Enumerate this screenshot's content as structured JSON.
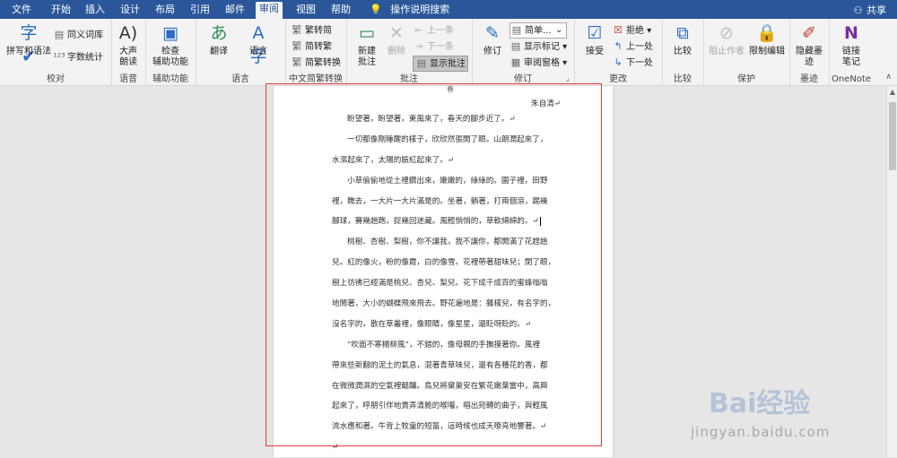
{
  "menu": {
    "tabs": [
      "文件",
      "开始",
      "插入",
      "设计",
      "布局",
      "引用",
      "邮件",
      "审阅",
      "视图",
      "帮助",
      "操作说明搜索"
    ],
    "active": "审阅",
    "share": "共享"
  },
  "ribbon": {
    "proofing": {
      "spell": "拼写和语法",
      "thesaurus": "同义词库",
      "wordcount": "字数统计",
      "label": "校对"
    },
    "speech": {
      "readaloud_1": "大声",
      "readaloud_2": "朗读",
      "label": "语音"
    },
    "accessibility": {
      "check_1": "检查",
      "check_2": "辅助功能",
      "label": "辅助功能"
    },
    "language": {
      "translate": "翻译",
      "language": "语言",
      "label": "语言"
    },
    "chinese": {
      "t2s": "繁转简",
      "s2t": "简转繁",
      "convert": "简繁转换",
      "label": "中文简繁转换"
    },
    "comments": {
      "new_1": "新建",
      "new_2": "批注",
      "delete": "删除",
      "prev": "上一条",
      "next": "下一条",
      "show": "显示批注",
      "label": "批注"
    },
    "tracking": {
      "track": "修订",
      "markup_select": "简单...",
      "show_markup": "显示标记",
      "review_pane": "审阅窗格",
      "label": "修订"
    },
    "changes": {
      "accept": "接受",
      "reject": "拒绝",
      "previous": "上一处",
      "next": "下一处",
      "label": "更改"
    },
    "compare": {
      "compare": "比较",
      "label": "比较"
    },
    "protect": {
      "block": "阻止作者",
      "restrict": "限制编辑",
      "label": "保护"
    },
    "ink": {
      "hide_1": "隐藏墨",
      "hide_2": "迹",
      "label": "墨迹"
    },
    "onenote": {
      "link_1": "链接",
      "link_2": "笔记",
      "label": "OneNote"
    }
  },
  "document": {
    "top_mark": "春",
    "author": "朱自清↵",
    "lines": [
      {
        "t": "盼望著，盼望著，東風來了，春天的腳步近了。↵",
        "indent": true
      },
      {
        "t": "一切都像剛睡醒的樣子，欣欣然張開了眼。山朗潤起來了，",
        "indent": true
      },
      {
        "t": "水漲起來了，太陽的臉紅起來了。↵",
        "indent": false
      },
      {
        "t": "小草偷偷地從土裡鑽出來，嫩嫩的，綠綠的。園子裡，田野",
        "indent": true
      },
      {
        "t": "裡，瞧去，一大片一大片滿是的。坐著，躺著，打兩個滾，踢幾",
        "indent": false
      },
      {
        "t": "腳球，賽幾趟跑，捉幾回迷藏。風輕悄悄的，草軟綿綿的。↵",
        "indent": false
      },
      {
        "t": "桃樹、杏樹、梨樹，你不讓我，我不讓你，都開滿了花趕趟",
        "indent": true
      },
      {
        "t": "兒。紅的像火，粉的像霞，白的像雪。花裡帶著甜味兒；閉了眼，",
        "indent": false
      },
      {
        "t": "樹上彷彿已經滿是桃兒、杏兒、梨兒。花下成千成百的蜜蜂嗡嗡",
        "indent": false
      },
      {
        "t": "地鬧著，大小的蝴蝶飛來飛去。野花遍地是：雜樣兒，有名字的，",
        "indent": false
      },
      {
        "t": "沒名字的，散在草叢裡，像眼睛，像星星，還眨呀眨的。↵",
        "indent": false
      },
      {
        "t": "“吹面不寒楊柳風”，不錯的，像母親的手撫摸著你。風裡",
        "indent": true
      },
      {
        "t": "帶來些新翻的泥土的氣息，混著青草味兒，還有各種花的香，都",
        "indent": false
      },
      {
        "t": "在微微潤濕的空氣裡醞釀。鳥兒將窠巢安在繁花嫩葉當中，高興",
        "indent": false
      },
      {
        "t": "起來了，呼朋引伴地賣弄清脆的喉嚨，唱出宛轉的曲子，與輕風",
        "indent": false
      },
      {
        "t": "流水應和著。牛背上牧童的短笛，這時候也成天嘹亮地響著。↵",
        "indent": false
      },
      {
        "t": "↵",
        "indent": false
      }
    ]
  },
  "watermark": {
    "brand": "Bai经验",
    "url": "jingyan.baidu.com"
  }
}
